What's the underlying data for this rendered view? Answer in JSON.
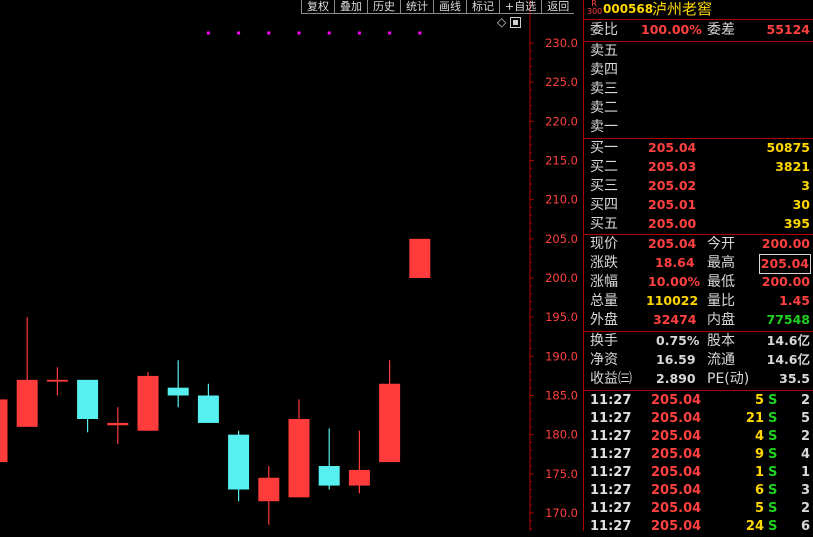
{
  "toolbar": [
    "复权",
    "叠加",
    "历史",
    "统计",
    "画线",
    "标记",
    "+自选",
    "返回"
  ],
  "chart_icons": [
    "diamond-icon",
    "square-icon"
  ],
  "chart_data": {
    "type": "candlestick",
    "y_ticks": [
      "230.0",
      "225.0",
      "220.0",
      "215.0",
      "210.0",
      "205.0",
      "200.0",
      "195.0",
      "190.0",
      "185.0",
      "180.0",
      "175.0",
      "170.0"
    ],
    "ylim": [
      168.5,
      232
    ],
    "up_color": "#ff3b3b",
    "down_color": "#56f0f0",
    "candles": [
      {
        "o": 176.5,
        "c": 184.5,
        "h": 184.5,
        "l": 176.5
      },
      {
        "o": 181.0,
        "c": 187.0,
        "h": 195.0,
        "l": 181.0
      },
      {
        "o": 187.0,
        "c": 187.0,
        "h": 188.6,
        "l": 185.0
      },
      {
        "o": 187.0,
        "c": 182.0,
        "h": 187.0,
        "l": 180.3
      },
      {
        "o": 181.2,
        "c": 181.5,
        "h": 183.5,
        "l": 178.8
      },
      {
        "o": 180.5,
        "c": 187.5,
        "h": 188.0,
        "l": 180.5
      },
      {
        "o": 186.0,
        "c": 185.0,
        "h": 189.5,
        "l": 183.5
      },
      {
        "o": 185.0,
        "c": 181.5,
        "h": 186.5,
        "l": 181.5
      },
      {
        "o": 180.0,
        "c": 173.0,
        "h": 180.5,
        "l": 171.5
      },
      {
        "o": 171.5,
        "c": 174.5,
        "h": 176.0,
        "l": 168.5
      },
      {
        "o": 172.0,
        "c": 182.0,
        "h": 184.5,
        "l": 172.0
      },
      {
        "o": 176.0,
        "c": 173.5,
        "h": 180.8,
        "l": 173.0
      },
      {
        "o": 173.5,
        "c": 175.5,
        "h": 180.5,
        "l": 172.5
      },
      {
        "o": 176.5,
        "c": 186.5,
        "h": 189.5,
        "l": 176.5
      },
      {
        "o": 200.0,
        "c": 205.0,
        "h": 205.0,
        "l": 200.0
      }
    ],
    "marker_color": "#ff00ff"
  },
  "header": {
    "market_tag": "R",
    "market_sub": "300",
    "code": "000568",
    "name": "泸州老窖"
  },
  "weibi": {
    "label": "委比",
    "value": "100.00%",
    "label2": "委差",
    "value2": "55124"
  },
  "sell": [
    {
      "label": "卖五"
    },
    {
      "label": "卖四"
    },
    {
      "label": "卖三"
    },
    {
      "label": "卖二"
    },
    {
      "label": "卖一"
    }
  ],
  "buy": [
    {
      "label": "买一",
      "price": "205.04",
      "vol": "50875"
    },
    {
      "label": "买二",
      "price": "205.03",
      "vol": "3821"
    },
    {
      "label": "买三",
      "price": "205.02",
      "vol": "3"
    },
    {
      "label": "买四",
      "price": "205.01",
      "vol": "30"
    },
    {
      "label": "买五",
      "price": "205.00",
      "vol": "395"
    }
  ],
  "quote": {
    "price_label": "现价",
    "price": "205.04",
    "open_label": "今开",
    "open": "200.00",
    "chg_label": "涨跌",
    "chg": "18.64",
    "high_label": "最高",
    "high": "205.04",
    "pct_label": "涨幅",
    "pct": "10.00%",
    "low_label": "最低",
    "low": "200.00",
    "vol_label": "总量",
    "vol": "110022",
    "ratio_label": "量比",
    "ratio": "1.45",
    "outer_label": "外盘",
    "outer": "32474",
    "inner_label": "内盘",
    "inner": "77548"
  },
  "fund": {
    "turn_label": "换手",
    "turn": "0.75%",
    "cap_label": "股本",
    "cap": "14.6亿",
    "nav_label": "净资",
    "nav": "16.59",
    "float_label": "流通",
    "float": "14.6亿",
    "eps_label": "收益㈢",
    "eps": "2.890",
    "pe_label": "PE(动)",
    "pe": "35.5"
  },
  "ticks": [
    {
      "t": "11:27",
      "p": "205.04",
      "q": "5",
      "s": "S",
      "n": "2"
    },
    {
      "t": "11:27",
      "p": "205.04",
      "q": "21",
      "s": "S",
      "n": "5"
    },
    {
      "t": "11:27",
      "p": "205.04",
      "q": "4",
      "s": "S",
      "n": "2"
    },
    {
      "t": "11:27",
      "p": "205.04",
      "q": "9",
      "s": "S",
      "n": "4"
    },
    {
      "t": "11:27",
      "p": "205.04",
      "q": "1",
      "s": "S",
      "n": "1"
    },
    {
      "t": "11:27",
      "p": "205.04",
      "q": "6",
      "s": "S",
      "n": "3"
    },
    {
      "t": "11:27",
      "p": "205.04",
      "q": "5",
      "s": "S",
      "n": "2"
    },
    {
      "t": "11:27",
      "p": "205.04",
      "q": "24",
      "s": "S",
      "n": "6"
    }
  ]
}
